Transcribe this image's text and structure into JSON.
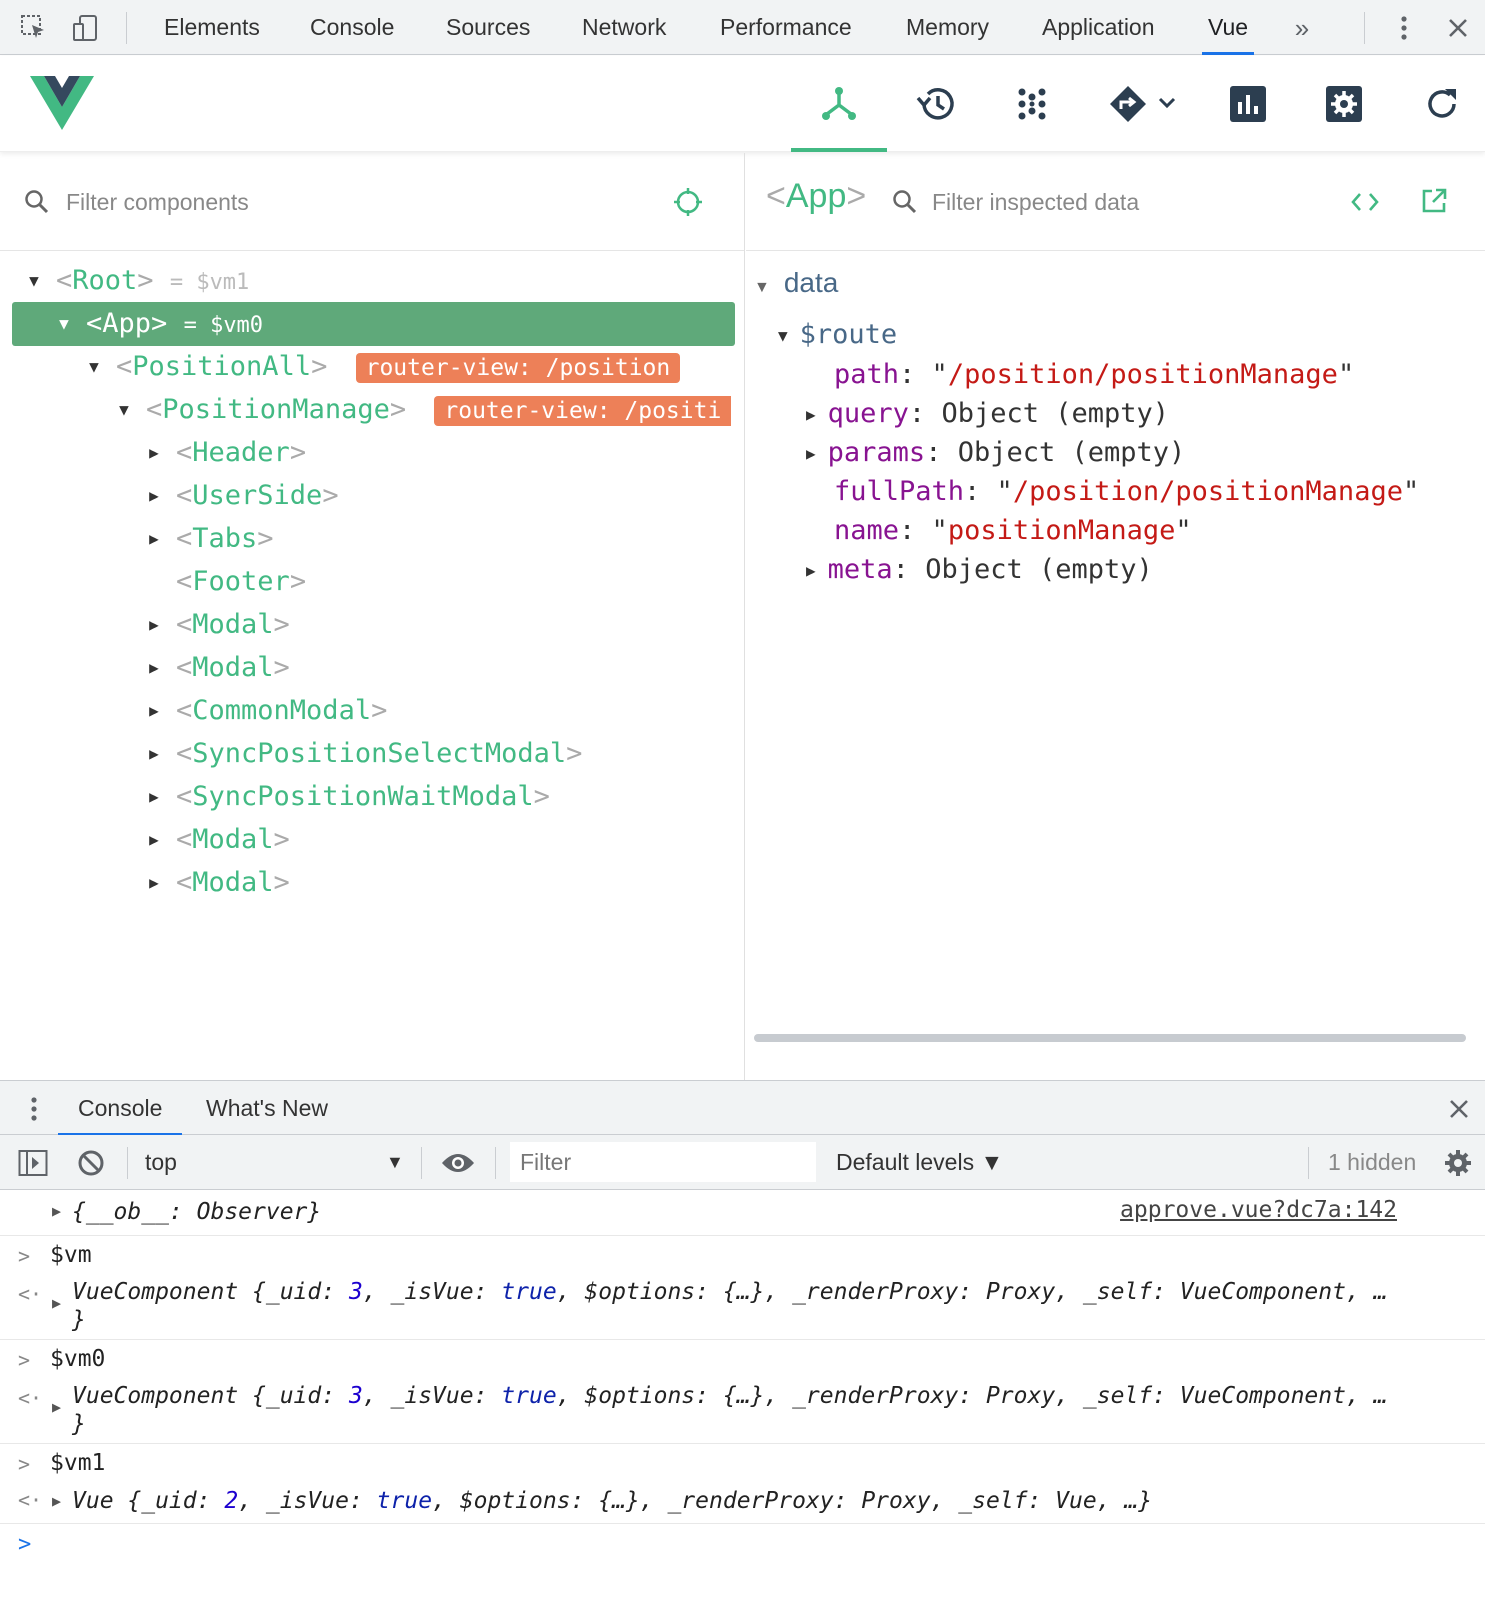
{
  "devtools": {
    "tabs": [
      "Elements",
      "Console",
      "Sources",
      "Network",
      "Performance",
      "Memory",
      "Application",
      "Vue"
    ],
    "active_tab": "Vue",
    "more_icon": "chevron-double-right-icon"
  },
  "vue_toolbar": {
    "tools": [
      "components-icon",
      "history-icon",
      "vuex-icon",
      "router-icon",
      "performance-icon",
      "settings-icon",
      "refresh-icon"
    ],
    "active_tool": "components-icon"
  },
  "components": {
    "filter_placeholder": "Filter components",
    "tree": [
      {
        "name": "Root",
        "vm": "= $vm1",
        "expanded": true
      },
      {
        "name": "App",
        "vm": "= $vm0",
        "expanded": true,
        "selected": true
      },
      {
        "name": "PositionAll",
        "badge": "router-view: /position",
        "expanded": true
      },
      {
        "name": "PositionManage",
        "badge": "router-view: /positi",
        "expanded": true
      },
      {
        "name": "Header"
      },
      {
        "name": "UserSide"
      },
      {
        "name": "Tabs"
      },
      {
        "name": "Footer"
      },
      {
        "name": "Modal"
      },
      {
        "name": "Modal"
      },
      {
        "name": "CommonModal"
      },
      {
        "name": "SyncPositionSelectModal"
      },
      {
        "name": "SyncPositionWaitModal"
      },
      {
        "name": "Modal"
      },
      {
        "name": "Modal"
      }
    ]
  },
  "inspector": {
    "component": "App",
    "filter_placeholder": "Filter inspected data",
    "section": "data",
    "route_key": "$route",
    "props": [
      {
        "key": "path",
        "value": "/position/positionManage",
        "type": "string"
      },
      {
        "key": "query",
        "value": "Object (empty)",
        "type": "object"
      },
      {
        "key": "params",
        "value": "Object (empty)",
        "type": "object"
      },
      {
        "key": "fullPath",
        "value": "/position/positionManage",
        "type": "string"
      },
      {
        "key": "name",
        "value": "positionManage",
        "type": "string"
      },
      {
        "key": "meta",
        "value": "Object (empty)",
        "type": "object"
      }
    ]
  },
  "drawer": {
    "tabs": [
      "Console",
      "What's New"
    ],
    "context": "top",
    "filter_placeholder": "Filter",
    "levels": "Default levels ▼",
    "hidden": "1 hidden"
  },
  "console": {
    "row1": {
      "text": "{__ob__: Observer}",
      "source": "approve.vue?dc7a:142"
    },
    "cmd1": "$vm",
    "res1": {
      "prefix": "VueComponent {_uid: ",
      "uid": "3",
      "mid": ", _isVue: ",
      "isvue": "true",
      "rest": ", $options: {…}, _renderProxy: Proxy, _self: VueComponent, …",
      "close": "}"
    },
    "cmd2": "$vm0",
    "res2": {
      "prefix": "VueComponent {_uid: ",
      "uid": "3",
      "mid": ", _isVue: ",
      "isvue": "true",
      "rest": ", $options: {…}, _renderProxy: Proxy, _self: VueComponent, …",
      "close": "}"
    },
    "cmd3": "$vm1",
    "res3": {
      "prefix": "Vue {_uid: ",
      "uid": "2",
      "mid": ", _isVue: ",
      "isvue": "true",
      "rest": ", $options: {…}, _renderProxy: Proxy, _self: Vue, …}"
    }
  }
}
